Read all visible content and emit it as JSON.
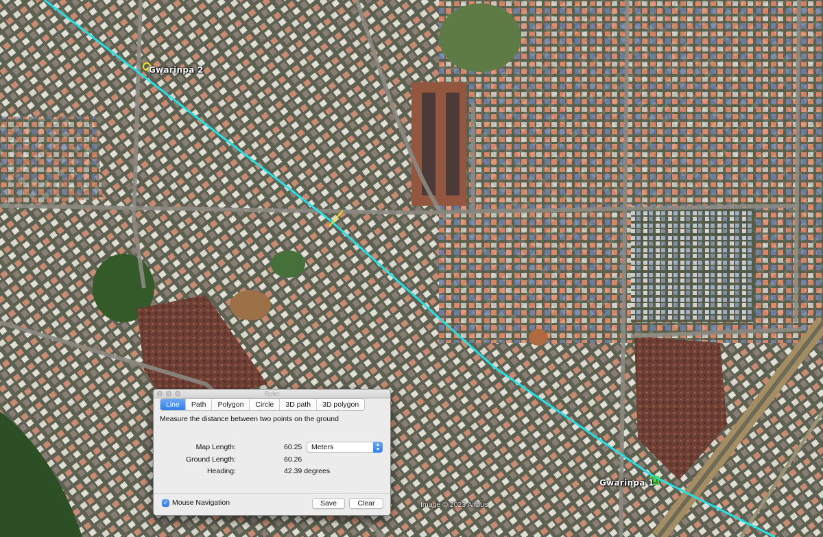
{
  "map": {
    "placemarks": [
      {
        "name": "Gwarinpa 2",
        "marker": "yellow-circle-pushpin",
        "color": "#f5e11a"
      },
      {
        "name": "Gwarinpa 1",
        "marker": "green-square-pushpin",
        "color": "#2fe43a"
      }
    ],
    "path_color": "#22e1e6",
    "measure_line_color": "#f2e51c",
    "attribution": "Image © 2023 Airbus"
  },
  "ruler": {
    "title": "Ruler",
    "tabs": [
      {
        "label": "Line",
        "active": true
      },
      {
        "label": "Path",
        "active": false
      },
      {
        "label": "Polygon",
        "active": false
      },
      {
        "label": "Circle",
        "active": false
      },
      {
        "label": "3D path",
        "active": false
      },
      {
        "label": "3D polygon",
        "active": false
      }
    ],
    "description": "Measure the distance between two points on the ground",
    "map_length_label": "Map Length:",
    "map_length_value": "60.25",
    "unit_selected": "Meters",
    "ground_length_label": "Ground Length:",
    "ground_length_value": "60.26",
    "heading_label": "Heading:",
    "heading_value": "42.39 degrees",
    "mouse_navigation_label": "Mouse Navigation",
    "mouse_navigation_checked": true,
    "save_label": "Save",
    "clear_label": "Clear"
  }
}
